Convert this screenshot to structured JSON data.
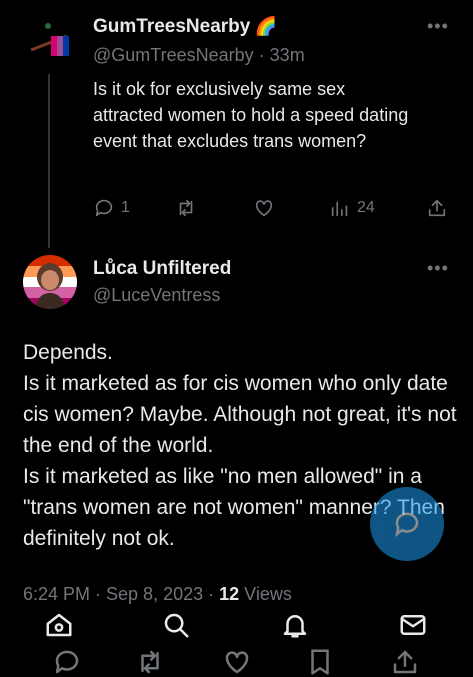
{
  "reply_tweet": {
    "display_name": "GumTreesNearby",
    "name_emoji": "🌈",
    "handle": "@GumTreesNearby",
    "time_ago": "· 33m",
    "text": "Is it ok for exclusively same sex attracted women to hold a speed dating event that excludes trans women?",
    "reply_count": "1",
    "view_count": "24"
  },
  "main_tweet": {
    "display_name": "Lůca Unfiltered",
    "handle": "@LuceVentress",
    "text_lines": [
      "Depends.",
      "Is it marketed as for cis women who only date cis women? Maybe. Although not great, it's not the end of the world.",
      "Is it marketed as like \"no men allowed\" in a \"trans women are not women\" manner? Then definitely not ok."
    ],
    "timestamp": "6:24 PM · Sep 8, 2023 · ",
    "views_count": "12",
    "views_label": "Views"
  },
  "icons": {
    "more": "more-icon",
    "reply": "reply-icon",
    "retweet": "retweet-icon",
    "like": "heart-icon",
    "views": "views-icon",
    "share": "share-icon",
    "compose": "compose-icon",
    "nav": [
      "home-icon",
      "search-icon",
      "notifications-icon",
      "messages-icon"
    ]
  },
  "colors": {
    "background": "#000000",
    "text": "#e7e9ea",
    "muted": "#71767b",
    "accent": "#1d9bf0"
  }
}
